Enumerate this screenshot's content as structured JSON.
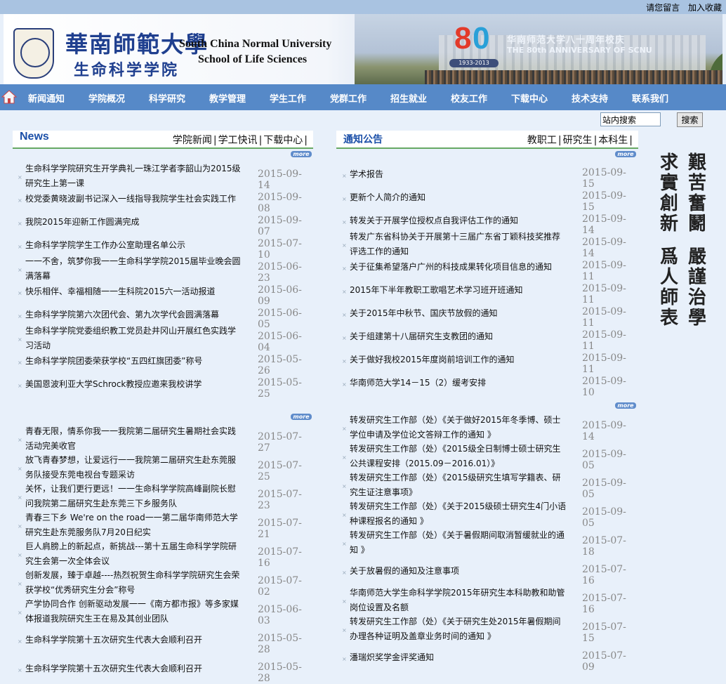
{
  "topbar": {
    "leave_message": "请您留言",
    "favorite": "加入收藏"
  },
  "banner": {
    "cn_name": "華南師範大學",
    "cn_school": "生命科学学院",
    "en_name": "South China Normal University",
    "en_school": "School of Life Sciences",
    "anniv_cn": "华南师范大学八十周年校庆",
    "anniv_en": "THE 80th ANNIVERSARY OF SCNU",
    "logo_years": "1933-2013"
  },
  "nav": [
    "新闻通知",
    "学院概况",
    "科学研究",
    "教学管理",
    "学生工作",
    "党群工作",
    "招生就业",
    "校友工作",
    "下载中心",
    "技术支持",
    "联系我们"
  ],
  "search": {
    "value": "站内搜索",
    "button": "搜索"
  },
  "news": {
    "title": "News",
    "tabs": [
      "学院新闻",
      "学工快讯",
      "下载中心"
    ],
    "more": "more",
    "list1": [
      {
        "title": "生命科学学院研究生开学典礼一珠江学者李韶山为2015级研究生上第一课",
        "date": "2015-09-14"
      },
      {
        "title": "校党委黄晓波副书记深入一线指导我院学生社会实践工作",
        "date": "2015-09-08"
      },
      {
        "title": "我院2015年迎新工作圆满完成",
        "date": "2015-09-07"
      },
      {
        "title": "生命科学学院学生工作办公室助理名单公示",
        "date": "2015-07-10"
      },
      {
        "title": "一一不舍，筑梦你我一一生命科学学院2015届毕业晚会圆满落幕",
        "date": "2015-06-23"
      },
      {
        "title": "快乐相伴、幸福相随一一生科院2015六一活动报道",
        "date": "2015-06-09"
      },
      {
        "title": "生命科学学院第六次团代会、第九次学代会圆满落幕",
        "date": "2015-06-05"
      },
      {
        "title": "生命科学学院党委组织教工党员赴井冈山开展红色实践学习活动",
        "date": "2015-06-04"
      },
      {
        "title": "生命科学学院团委荣获学校“五四红旗团委”称号",
        "date": "2015-05-26"
      },
      {
        "title": "美国恩波利亚大学Schrock教授应邀来我校讲学",
        "date": "2015-05-25"
      }
    ],
    "list2": [
      {
        "title": "青春无限，情系你我一一我院第二届研究生暑期社会实践活动完美收官",
        "date": "2015-07-27"
      },
      {
        "title": "放飞青春梦想，让爱远行一一我院第二届研究生赴东莞服务队接受东莞电视台专题采访",
        "date": "2015-07-25"
      },
      {
        "title": "关怀，让我们更行更远！一一生命科学学院高峰副院长慰问我院第二届研究生赴东莞三下乡服务队",
        "date": "2015-07-23"
      },
      {
        "title": "青春三下乡 We're on the road一一第二届华南师范大学研究生赴东莞服务队7月20日纪实",
        "date": "2015-07-21"
      },
      {
        "title": "巨人肩膀上的新起点，新挑战---第十五届生命科学学院研究生会第一次全体会议",
        "date": "2015-07-16"
      },
      {
        "title": "创新发展，臻于卓越----热烈祝贺生命科学学院研究生会荣获学校“优秀研究生分会”称号",
        "date": "2015-07-02"
      },
      {
        "title": "产学协同合作 创新驱动发展一一《南方都市报》等多家媒体报道我院研究生王在易及其创业团队",
        "date": "2015-06-03"
      },
      {
        "title": "生命科学学院第十五次研究生代表大会顺利召开",
        "date": "2015-05-28"
      },
      {
        "title": "生命科学学院第十五次研究生代表大会顺利召开",
        "date": "2015-05-28"
      }
    ]
  },
  "notice": {
    "title": "通知公告",
    "tabs": [
      "教职工",
      "研究生",
      "本科生"
    ],
    "more": "more",
    "list1": [
      {
        "title": "学术报告",
        "date": "2015-09-15"
      },
      {
        "title": "更新个人简介的通知",
        "date": "2015-09-15"
      },
      {
        "title": "转发关于开展学位授权点自我评估工作的通知",
        "date": "2015-09-14"
      },
      {
        "title": "转发广东省科协关于开展第十三届广东省丁颖科技奖推荐评选工作的通知",
        "date": "2015-09-14"
      },
      {
        "title": "关于征集希望落户广州的科技成果转化项目信息的通知",
        "date": "2015-09-11"
      },
      {
        "title": "2015年下半年教职工歌唱艺术学习班开班通知",
        "date": "2015-09-11"
      },
      {
        "title": "关于2015年中秋节、国庆节放假的通知",
        "date": "2015-09-11"
      },
      {
        "title": "关于组建第十八届研究生支教团的通知",
        "date": "2015-09-11"
      },
      {
        "title": "关于做好我校2015年度岗前培训工作的通知",
        "date": "2015-09-11"
      },
      {
        "title": "华南师范大学14－15（2）缓考安排",
        "date": "2015-09-10"
      }
    ],
    "list2": [
      {
        "title": "转发研究生工作部（处）《关于做好2015年冬季博、硕士学位申请及学位论文答辩工作的通知 》",
        "date": "2015-09-14"
      },
      {
        "title": "转发研究生工作部（处）《2015级全日制博士硕士研究生公共课程安排（2015.09－2016.01）》",
        "date": "2015-09-05"
      },
      {
        "title": "转发研究生工作部（处）《2015级研究生填写学籍表、研究生证注意事项》",
        "date": "2015-09-05"
      },
      {
        "title": "转发研究生工作部（处）《关于2015级硕士研究生4门小语种课程报名的通知 》",
        "date": "2015-09-05"
      },
      {
        "title": "转发研究生工作部（处）《关于暑假期间取消暂缓就业的通知 》",
        "date": "2015-07-18"
      },
      {
        "title": "关于放暑假的通知及注意事项",
        "date": "2015-07-16"
      },
      {
        "title": "华南师范大学生命科学学院2015年研究生本科助教和助管岗位设置及名额",
        "date": "2015-07-16"
      },
      {
        "title": "转发研究生工作部（处）《关于研究生处2015年暑假期间办理各种证明及盖章业务时间的通知 》",
        "date": "2015-07-15"
      },
      {
        "title": "潘瑞炽奖学金评奖通知",
        "date": "2015-07-09"
      }
    ]
  },
  "motto": {
    "col_right": "艱苦奮鬭嚴謹治學",
    "col_left": "求實創新爲人師表"
  },
  "colors": {
    "nav_bg": "#5689c8",
    "page_bg": "#e8f0fa",
    "accent_line": "#66a864",
    "title_blue": "#1b4fa8"
  }
}
